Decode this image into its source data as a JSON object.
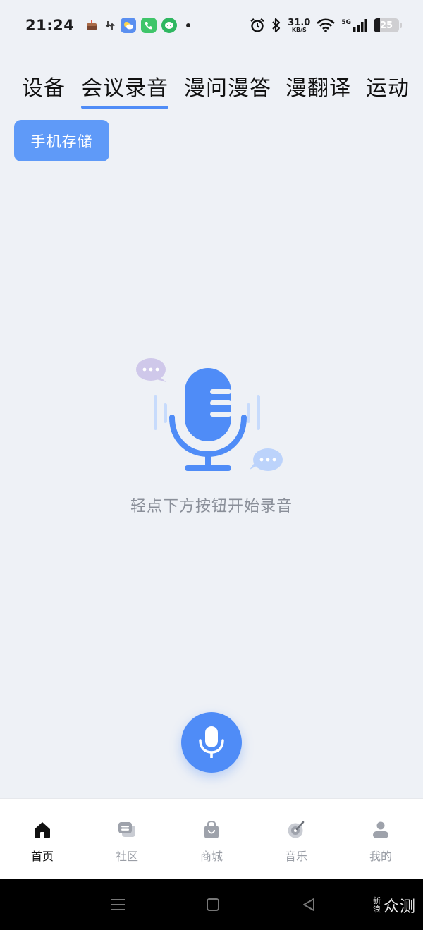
{
  "status_bar": {
    "time": "21:24",
    "net_speed_value": "31.0",
    "net_speed_unit": "KB/S",
    "network_type": "5G",
    "battery_level": "25"
  },
  "tabs": [
    {
      "label": "设备",
      "active": false
    },
    {
      "label": "会议录音",
      "active": true
    },
    {
      "label": "漫问漫答",
      "active": false
    },
    {
      "label": "漫翻译",
      "active": false
    },
    {
      "label": "运动",
      "active": false
    }
  ],
  "storage_button": {
    "label": "手机存储"
  },
  "empty_state": {
    "hint": "轻点下方按钮开始录音"
  },
  "bottom_nav": [
    {
      "label": "首页",
      "icon": "home-icon",
      "active": true
    },
    {
      "label": "社区",
      "icon": "community-icon",
      "active": false
    },
    {
      "label": "商城",
      "icon": "shopping-bag-icon",
      "active": false
    },
    {
      "label": "音乐",
      "icon": "music-icon",
      "active": false
    },
    {
      "label": "我的",
      "icon": "profile-icon",
      "active": false
    }
  ],
  "watermark": {
    "small_top": "新",
    "small_bottom": "浪",
    "big": "众测"
  },
  "colors": {
    "accent": "#4f8cf7",
    "background": "#eef1f6",
    "storage_button": "#5f9af8",
    "hint_text": "#8a8f99"
  }
}
